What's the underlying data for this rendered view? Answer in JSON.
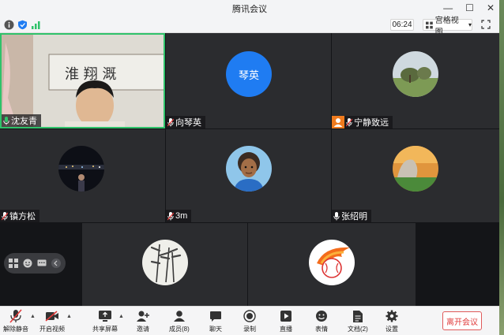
{
  "window": {
    "title": "腾讯会议",
    "minimize": "—",
    "maximize": "☐",
    "close": "✕"
  },
  "status": {
    "timer": "06:24",
    "view_label": "宫格视图",
    "view_caret": "▾"
  },
  "participants": [
    {
      "name": "沈友青",
      "speaking": true,
      "video": true
    },
    {
      "name": "向琴英",
      "avatar_text": "琴英",
      "avatar_color": "#1f7cf2"
    },
    {
      "name": "宁静致远",
      "badge": "host"
    },
    {
      "name": "镇方松"
    },
    {
      "name": "3m"
    },
    {
      "name": "张绍明"
    },
    {
      "name": ""
    },
    {
      "name": ""
    }
  ],
  "toolbar": {
    "mute_label": "解除静音",
    "video_label": "开启视频",
    "share_label": "共享屏幕",
    "invite_label": "邀请",
    "members_label": "成员(8)",
    "chat_label": "聊天",
    "record_label": "录制",
    "live_label": "直播",
    "emoji_label": "表情",
    "docs_label": "文档(2)",
    "settings_label": "设置",
    "leave_label": "离开会议"
  },
  "colors": {
    "accent": "#1f7cf2",
    "active_border": "#2fc26a",
    "leave": "#e03c3c"
  }
}
